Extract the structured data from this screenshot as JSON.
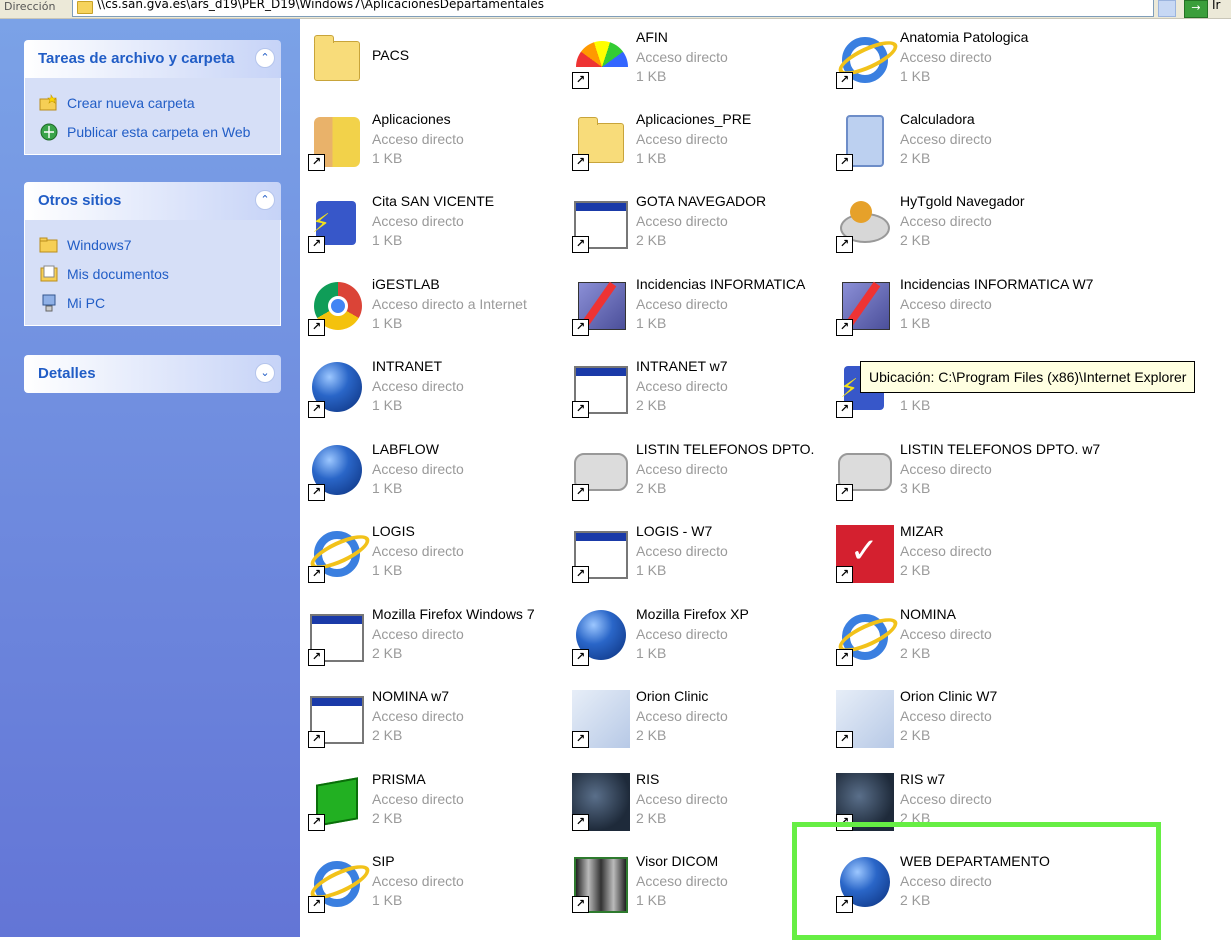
{
  "address_bar": {
    "label": "Dirección",
    "path": "\\\\cs.san.gva.es\\ars_d19\\PER_D19\\Windows7\\AplicacionesDepartamentales",
    "go_label": "Ir"
  },
  "task_pane": {
    "file_tasks": {
      "title": "Tareas de archivo y carpeta",
      "links": [
        {
          "label": "Crear nueva carpeta",
          "icon": "new-folder-icon"
        },
        {
          "label": "Publicar esta carpeta en Web",
          "icon": "publish-web-icon"
        }
      ]
    },
    "other_places": {
      "title": "Otros sitios",
      "links": [
        {
          "label": "Windows7",
          "icon": "folder-icon"
        },
        {
          "label": "Mis documentos",
          "icon": "my-documents-icon"
        },
        {
          "label": "Mi PC",
          "icon": "my-computer-icon"
        }
      ]
    },
    "details": {
      "title": "Detalles"
    }
  },
  "files": [
    {
      "name": "PACS",
      "type": "",
      "size": "",
      "icon": "folder-icon"
    },
    {
      "name": "AFIN",
      "type": "Acceso directo",
      "size": "1 KB",
      "icon": "rainbow-icon"
    },
    {
      "name": "Anatomia Patologica",
      "type": "Acceso directo",
      "size": "1 KB",
      "icon": "internet-explorer-icon"
    },
    {
      "name": "Aplicaciones",
      "type": "Acceso directo",
      "size": "1 KB",
      "icon": "door-person-icon"
    },
    {
      "name": "Aplicaciones_PRE",
      "type": "Acceso directo",
      "size": "1 KB",
      "icon": "folder-icon"
    },
    {
      "name": "Calculadora",
      "type": "Acceso directo",
      "size": "2 KB",
      "icon": "calculator-icon"
    },
    {
      "name": "Cita SAN VICENTE",
      "type": "Acceso directo",
      "size": "1 KB",
      "icon": "plug-icon"
    },
    {
      "name": "GOTA NAVEGADOR",
      "type": "Acceso directo",
      "size": "2 KB",
      "icon": "window-icon"
    },
    {
      "name": "HyTgold Navegador",
      "type": "Acceso directo",
      "size": "2 KB",
      "icon": "disk-icon"
    },
    {
      "name": "iGESTLAB",
      "type": "Acceso directo a Internet",
      "size": "1 KB",
      "icon": "chrome-icon"
    },
    {
      "name": "Incidencias INFORMATICA",
      "type": "Acceso directo",
      "size": "1 KB",
      "icon": "tool-icon"
    },
    {
      "name": "Incidencias INFORMATICA W7",
      "type": "Acceso directo",
      "size": "1 KB",
      "icon": "tool-icon"
    },
    {
      "name": "INTRANET",
      "type": "Acceso directo",
      "size": "1 KB",
      "icon": "globe-icon"
    },
    {
      "name": "INTRANET w7",
      "type": "Acceso directo",
      "size": "2 KB",
      "icon": "window-icon"
    },
    {
      "name": "",
      "type": "Acceso directo",
      "size": "1 KB",
      "icon": "plug-icon"
    },
    {
      "name": "LABFLOW",
      "type": "Acceso directo",
      "size": "1 KB",
      "icon": "globe-icon"
    },
    {
      "name": "LISTIN TELEFONOS DPTO.",
      "type": "Acceso directo",
      "size": "2 KB",
      "icon": "phone-icon"
    },
    {
      "name": "LISTIN TELEFONOS DPTO. w7",
      "type": "Acceso directo",
      "size": "3 KB",
      "icon": "phone-icon"
    },
    {
      "name": "LOGIS",
      "type": "Acceso directo",
      "size": "1 KB",
      "icon": "internet-explorer-icon"
    },
    {
      "name": "LOGIS - W7",
      "type": "Acceso directo",
      "size": "1 KB",
      "icon": "window-icon"
    },
    {
      "name": "MIZAR",
      "type": "Acceso directo",
      "size": "2 KB",
      "icon": "mizar-icon"
    },
    {
      "name": "Mozilla Firefox Windows 7",
      "type": "Acceso directo",
      "size": "2 KB",
      "icon": "window-icon"
    },
    {
      "name": "Mozilla Firefox XP",
      "type": "Acceso directo",
      "size": "1 KB",
      "icon": "globe-icon"
    },
    {
      "name": "NOMINA",
      "type": "Acceso directo",
      "size": "2 KB",
      "icon": "internet-explorer-icon"
    },
    {
      "name": "NOMINA w7",
      "type": "Acceso directo",
      "size": "2 KB",
      "icon": "window-icon"
    },
    {
      "name": "Orion Clinic",
      "type": "Acceso directo",
      "size": "2 KB",
      "icon": "orion-icon"
    },
    {
      "name": "Orion Clinic W7",
      "type": "Acceso directo",
      "size": "2 KB",
      "icon": "orion-icon"
    },
    {
      "name": "PRISMA",
      "type": "Acceso directo",
      "size": "2 KB",
      "icon": "cube-icon"
    },
    {
      "name": "RIS",
      "type": "Acceso directo",
      "size": "2 KB",
      "icon": "space-icon"
    },
    {
      "name": "RIS w7",
      "type": "Acceso directo",
      "size": "2 KB",
      "icon": "space-icon"
    },
    {
      "name": "SIP",
      "type": "Acceso directo",
      "size": "1 KB",
      "icon": "internet-explorer-icon"
    },
    {
      "name": "Visor DICOM",
      "type": "Acceso directo",
      "size": "1 KB",
      "icon": "xray-icon"
    },
    {
      "name": "WEB DEPARTAMENTO",
      "type": "Acceso directo",
      "size": "2 KB",
      "icon": "globe-icon"
    }
  ],
  "tooltip": {
    "text": "Ubicación: C:\\Program Files (x86)\\Internet Explorer"
  },
  "highlight_color": "#66ee44"
}
